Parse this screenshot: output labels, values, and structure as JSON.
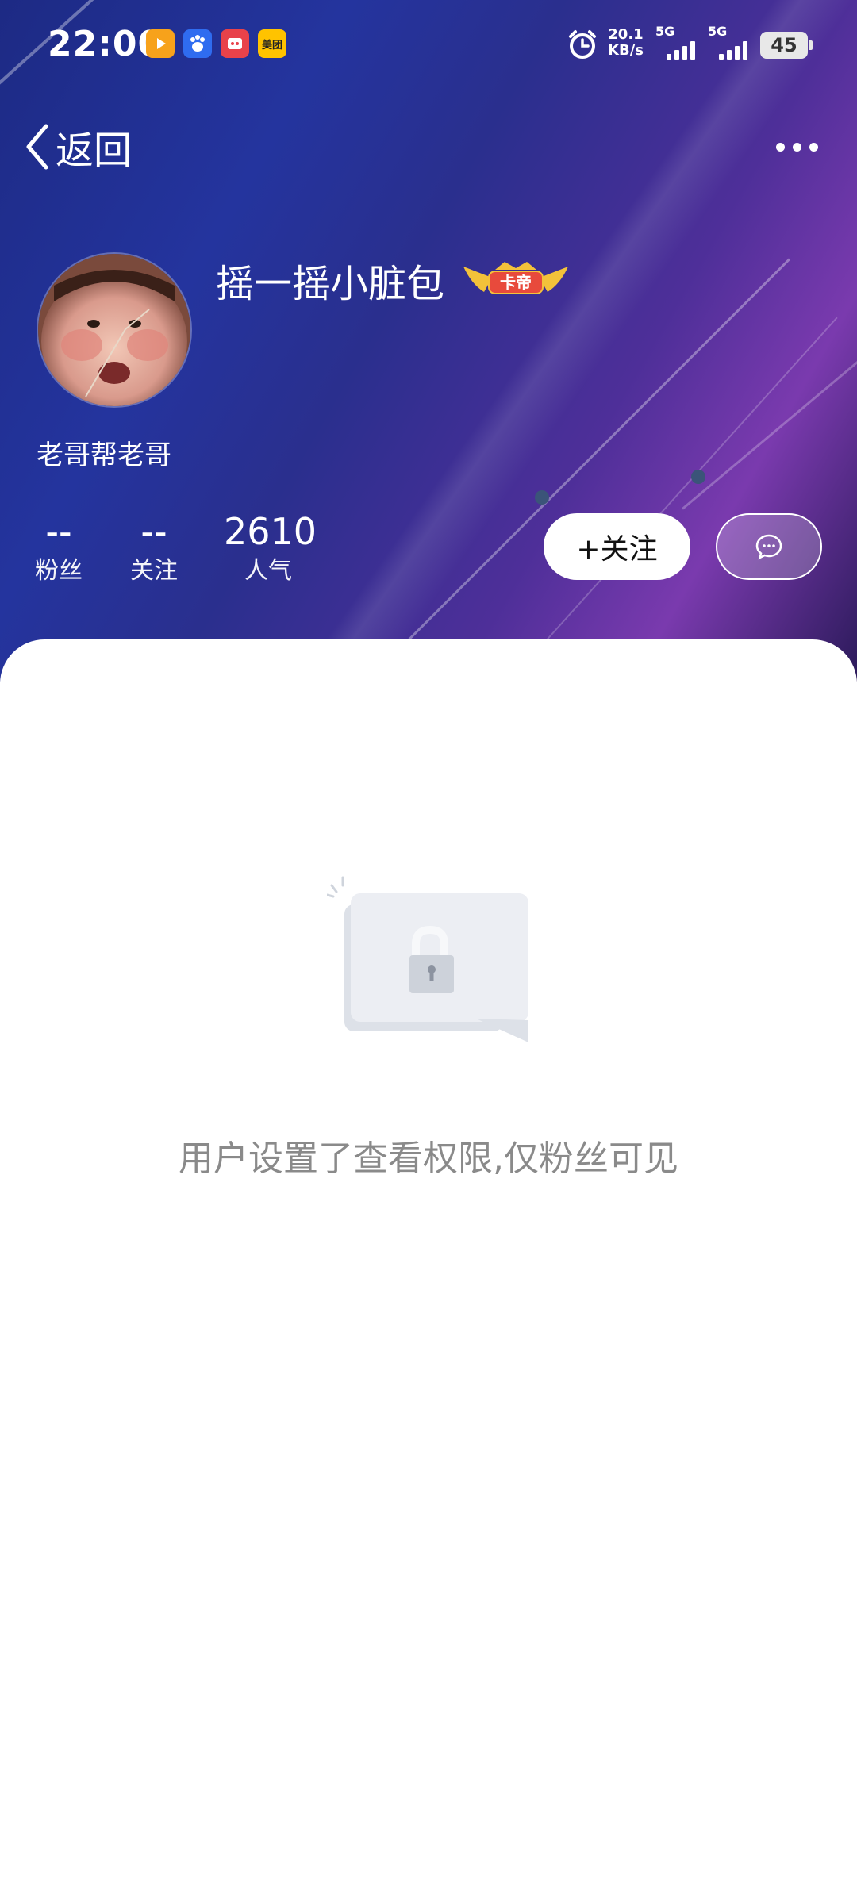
{
  "status_bar": {
    "time": "22:00",
    "apps": [
      {
        "name": "video-app-icon",
        "color": "#f7a21b"
      },
      {
        "name": "baidu-app-icon",
        "color": "#2f6cf0"
      },
      {
        "name": "game-app-icon",
        "color": "#e8424a"
      },
      {
        "name": "meituan-app-icon",
        "color": "#ffc300",
        "label": "美团"
      }
    ],
    "net_speed_value": "20.1",
    "net_speed_unit": "KB/s",
    "signal_1_label": "5G",
    "signal_2_label": "5G",
    "battery": "45"
  },
  "nav": {
    "back_label": "返回"
  },
  "profile": {
    "username": "摇一摇小脏包",
    "badge_text": "卡帝",
    "signature": "老哥帮老哥",
    "stats": [
      {
        "value": "--",
        "label": "粉丝"
      },
      {
        "value": "--",
        "label": "关注"
      },
      {
        "value": "2610",
        "label": "人气"
      }
    ],
    "follow_label": "+关注"
  },
  "content": {
    "private_message": "用户设置了查看权限,仅粉丝可见"
  },
  "colors": {
    "header_start": "#1d2a84",
    "header_end": "#7a3aae",
    "badge_red": "#e84a3c",
    "badge_gold": "#f3c23a",
    "muted_text": "#8a8a8a"
  }
}
